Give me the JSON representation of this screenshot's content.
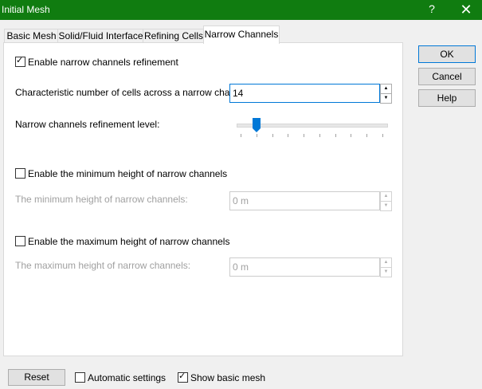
{
  "window": {
    "title": "Initial Mesh",
    "help_glyph": "?",
    "close_glyph": "✕"
  },
  "tabs": [
    {
      "label": "Basic Mesh"
    },
    {
      "label": "Solid/Fluid Interface"
    },
    {
      "label": "Refining Cells"
    },
    {
      "label": "Narrow Channels"
    }
  ],
  "narrow": {
    "enable_label": "Enable narrow channels refinement",
    "enable_checked": true,
    "cells_label": "Characteristic number of cells across a narrow channel:",
    "cells_value": "14",
    "level_label": "Narrow channels refinement level:",
    "level_value": 1,
    "level_max": 9,
    "min_enable_label": "Enable the minimum height of narrow channels",
    "min_enable_checked": false,
    "min_label": "The minimum height of narrow channels:",
    "min_value": "0 m",
    "max_enable_label": "Enable the maximum height of narrow channels",
    "max_enable_checked": false,
    "max_label": "The maximum height of narrow channels:",
    "max_value": "0 m"
  },
  "buttons": {
    "ok": "OK",
    "cancel": "Cancel",
    "help": "Help",
    "reset": "Reset"
  },
  "bottom": {
    "auto_label": "Automatic settings",
    "auto_checked": false,
    "show_label": "Show basic mesh",
    "show_checked": true
  },
  "icons": {
    "check_glyph": "✓",
    "spin_up": "▲",
    "spin_down": "▼"
  },
  "colors": {
    "titlebar": "#107c10",
    "slider_thumb": "#0078d7",
    "focus_border": "#0078d7"
  }
}
